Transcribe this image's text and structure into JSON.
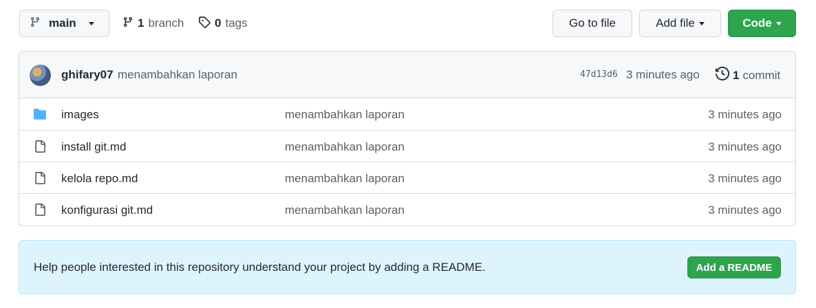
{
  "toolbar": {
    "branch_name": "main",
    "branch_count": "1",
    "branch_label": "branch",
    "tag_count": "0",
    "tag_label": "tags",
    "goto_file_label": "Go to file",
    "add_file_label": "Add file",
    "code_label": "Code"
  },
  "latest_commit": {
    "author": "ghifary07",
    "message": "menambahkan laporan",
    "sha": "47d13d6",
    "time": "3 minutes ago",
    "commit_count": "1",
    "commit_label": "commit"
  },
  "files": [
    {
      "icon": "folder-icon",
      "name": "images",
      "message": "menambahkan laporan",
      "time": "3 minutes ago"
    },
    {
      "icon": "file-icon",
      "name": "install git.md",
      "message": "menambahkan laporan",
      "time": "3 minutes ago"
    },
    {
      "icon": "file-icon",
      "name": "kelola repo.md",
      "message": "menambahkan laporan",
      "time": "3 minutes ago"
    },
    {
      "icon": "file-icon",
      "name": "konfigurasi git.md",
      "message": "menambahkan laporan",
      "time": "3 minutes ago"
    }
  ],
  "readme_prompt": {
    "text": "Help people interested in this repository understand your project by adding a README.",
    "button_label": "Add a README"
  },
  "colors": {
    "primary_green": "#2da44e",
    "folder_blue": "#54aeff",
    "banner_bg": "#ddf4ff"
  }
}
